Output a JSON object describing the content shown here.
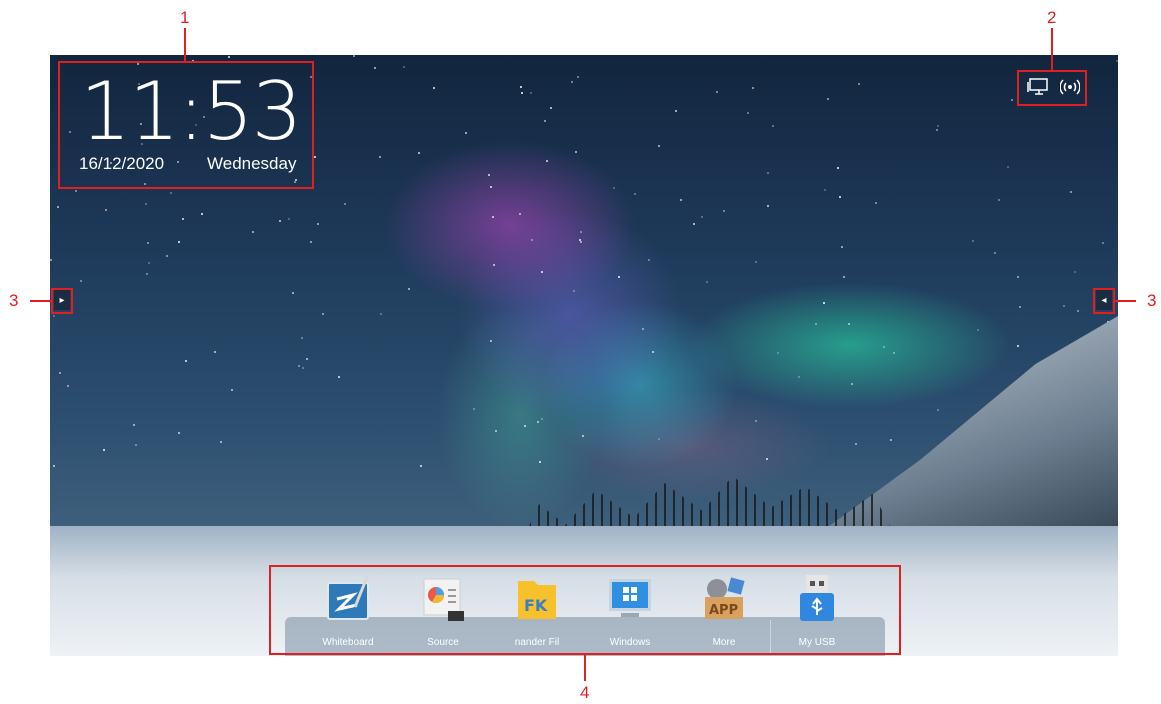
{
  "callouts": [
    "1",
    "2",
    "3",
    "3",
    "4"
  ],
  "clock": {
    "time": "11:53",
    "date": "16/12/2020",
    "day": "Wednesday"
  },
  "status": {
    "icons": [
      "ethernet-icon",
      "hotspot-icon"
    ]
  },
  "side_handles": {
    "left_icon": "▸",
    "right_icon": "◂"
  },
  "dock": {
    "items": [
      {
        "label": "Whiteboard",
        "icon": "whiteboard-icon"
      },
      {
        "label": "Source",
        "icon": "source-icon"
      },
      {
        "label": "nander     Fil",
        "icon": "file-commander-icon"
      },
      {
        "label": "Windows",
        "icon": "windows-icon"
      },
      {
        "label": "More",
        "icon": "more-apps-icon"
      },
      {
        "label": "My USB",
        "icon": "usb-icon"
      }
    ]
  },
  "colors": {
    "callout": "#e02020",
    "dock_bg": "#788ca0"
  }
}
